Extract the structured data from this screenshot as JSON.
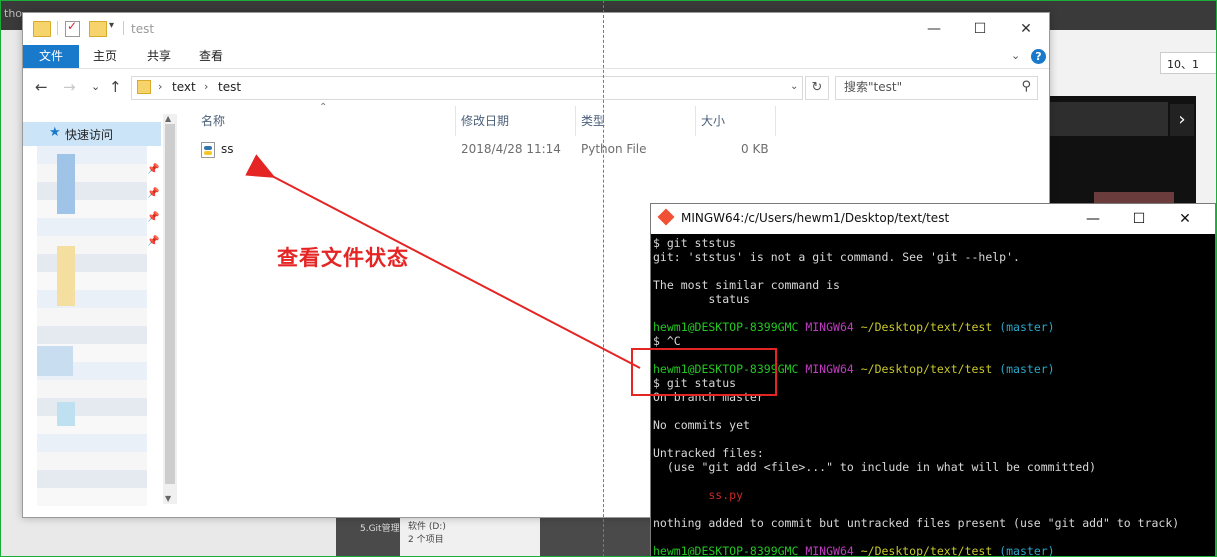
{
  "explorer": {
    "title": "test",
    "minimize": "—",
    "maximize": "☐",
    "close": "✕",
    "ribbon_tabs": [
      "文件",
      "主页",
      "共享",
      "查看"
    ],
    "ribbon_collapse": "⌄",
    "help": "?",
    "nav_back": "←",
    "nav_forward": "→",
    "nav_recent": "⌄",
    "nav_up": "↑",
    "breadcrumb": [
      "text",
      "test"
    ],
    "crumb_separator": "›",
    "refresh": "↻",
    "search_placeholder": "搜索\"test\"",
    "quick_access_label": "快速访问",
    "columns": {
      "name": "名称",
      "date": "修改日期",
      "type": "类型",
      "size": "大小"
    },
    "files": [
      {
        "name": "ss",
        "date": "2018/4/28 11:14",
        "type": "Python File",
        "size": "0 KB"
      }
    ]
  },
  "annotation": {
    "label": "查看文件状态"
  },
  "terminal": {
    "title": "MINGW64:/c/Users/hewm1/Desktop/text/test",
    "minimize": "—",
    "maximize": "☐",
    "close": "✕",
    "lines": [
      {
        "segments": [
          {
            "text": "$ git ststus",
            "color": "default"
          }
        ]
      },
      {
        "segments": [
          {
            "text": "git: 'ststus' is not a git command. See 'git --help'.",
            "color": "default"
          }
        ]
      },
      {
        "segments": [
          {
            "text": "",
            "color": "default"
          }
        ]
      },
      {
        "segments": [
          {
            "text": "The most similar command is",
            "color": "default"
          }
        ]
      },
      {
        "segments": [
          {
            "text": "        status",
            "color": "default"
          }
        ]
      },
      {
        "segments": [
          {
            "text": "",
            "color": "default"
          }
        ]
      },
      {
        "segments": [
          {
            "text": "hewm1@DESKTOP-8399GMC ",
            "color": "green"
          },
          {
            "text": "MINGW64 ",
            "color": "magenta"
          },
          {
            "text": "~/Desktop/text/test ",
            "color": "yellow"
          },
          {
            "text": "(master)",
            "color": "cyan"
          }
        ]
      },
      {
        "segments": [
          {
            "text": "$ ^C",
            "color": "default"
          }
        ]
      },
      {
        "segments": [
          {
            "text": "",
            "color": "default"
          }
        ]
      },
      {
        "segments": [
          {
            "text": "hewm1@DESKTOP-8399GMC ",
            "color": "green"
          },
          {
            "text": "MINGW64 ",
            "color": "magenta"
          },
          {
            "text": "~/Desktop/text/test ",
            "color": "yellow"
          },
          {
            "text": "(master)",
            "color": "cyan"
          }
        ]
      },
      {
        "segments": [
          {
            "text": "$ git status",
            "color": "default"
          }
        ]
      },
      {
        "segments": [
          {
            "text": "On branch master",
            "color": "default"
          }
        ]
      },
      {
        "segments": [
          {
            "text": "",
            "color": "default"
          }
        ]
      },
      {
        "segments": [
          {
            "text": "No commits yet",
            "color": "default"
          }
        ]
      },
      {
        "segments": [
          {
            "text": "",
            "color": "default"
          }
        ]
      },
      {
        "segments": [
          {
            "text": "Untracked files:",
            "color": "default"
          }
        ]
      },
      {
        "segments": [
          {
            "text": "  (use \"git add <file>...\" to include in what will be committed)",
            "color": "default"
          }
        ]
      },
      {
        "segments": [
          {
            "text": "",
            "color": "default"
          }
        ]
      },
      {
        "segments": [
          {
            "text": "        ss.py",
            "color": "red"
          }
        ]
      },
      {
        "segments": [
          {
            "text": "",
            "color": "default"
          }
        ]
      },
      {
        "segments": [
          {
            "text": "nothing added to commit but untracked files present (use \"git add\" to track)",
            "color": "default"
          }
        ]
      },
      {
        "segments": [
          {
            "text": "",
            "color": "default"
          }
        ]
      },
      {
        "segments": [
          {
            "text": "hewm1@DESKTOP-8399GMC ",
            "color": "green"
          },
          {
            "text": "MINGW64 ",
            "color": "magenta"
          },
          {
            "text": "~/Desktop/text/test ",
            "color": "yellow"
          },
          {
            "text": "(master)",
            "color": "cyan"
          }
        ]
      }
    ]
  },
  "background": {
    "tabbar_text": "tho",
    "next_arrow": "›",
    "input_value": "10、1",
    "bottom_text": "5.Git管理",
    "bottom_panel_line1": "软件 (D:)",
    "bottom_panel_line2": "2 个项目"
  },
  "colors": {
    "accent": "#1979ca",
    "annotation_red": "#e52424",
    "term_green": "#23c723",
    "term_magenta": "#c13cc1",
    "term_yellow": "#c8c82a",
    "term_cyan": "#29a8c9",
    "term_red": "#c72b2b"
  }
}
